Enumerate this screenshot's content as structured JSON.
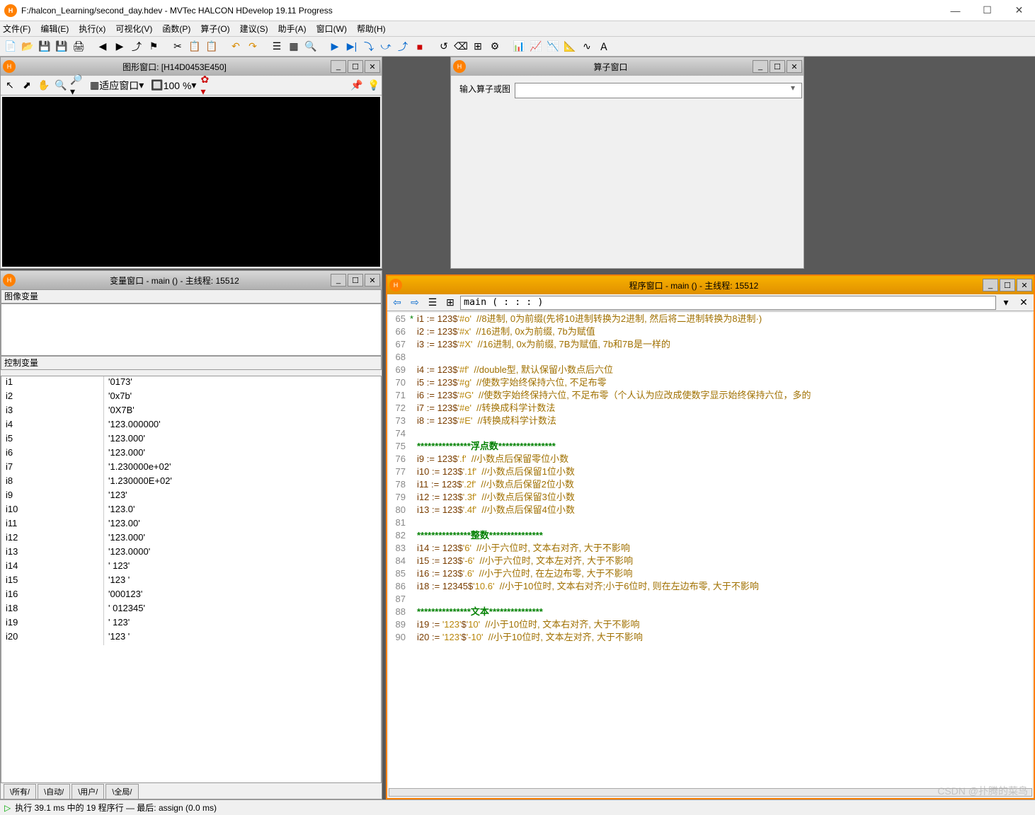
{
  "title": "F:/halcon_Learning/second_day.hdev - MVTec HALCON HDevelop 19.11 Progress",
  "window_controls": {
    "min": "—",
    "max": "☐",
    "close": "✕"
  },
  "menus": [
    "文件(F)",
    "编辑(E)",
    "执行(x)",
    "可视化(V)",
    "函数(P)",
    "算子(O)",
    "建议(S)",
    "助手(A)",
    "窗口(W)",
    "帮助(H)"
  ],
  "graphics_window": {
    "title": "图形窗口: [H14D0453E450]",
    "fit_label": "适应窗口",
    "zoom": "100 %"
  },
  "operator_window": {
    "title": "算子窗口",
    "input_label": "输入算子或图",
    "input_value": ""
  },
  "variable_window": {
    "title": "变量窗口 - main () - 主线程: 15512",
    "image_vars_label": "图像变量",
    "control_vars_label": "控制变量",
    "vars": [
      {
        "n": "i1",
        "v": "'0173'"
      },
      {
        "n": "i2",
        "v": "'0x7b'"
      },
      {
        "n": "i3",
        "v": "'0X7B'"
      },
      {
        "n": "i4",
        "v": "'123.000000'"
      },
      {
        "n": "i5",
        "v": "'123.000'"
      },
      {
        "n": "i6",
        "v": "'123.000'"
      },
      {
        "n": "i7",
        "v": "'1.230000e+02'"
      },
      {
        "n": "i8",
        "v": "'1.230000E+02'"
      },
      {
        "n": "i9",
        "v": "'123'"
      },
      {
        "n": "i10",
        "v": "'123.0'"
      },
      {
        "n": "i11",
        "v": "'123.00'"
      },
      {
        "n": "i12",
        "v": "'123.000'"
      },
      {
        "n": "i13",
        "v": "'123.0000'"
      },
      {
        "n": "i14",
        "v": "'   123'"
      },
      {
        "n": "i15",
        "v": "'123   '"
      },
      {
        "n": "i16",
        "v": "'000123'"
      },
      {
        "n": "i18",
        "v": "'    012345'"
      },
      {
        "n": "i19",
        "v": "'       123'"
      },
      {
        "n": "i20",
        "v": "'123       '"
      }
    ],
    "tabs": [
      "所有",
      "自动",
      "用户",
      "全局"
    ]
  },
  "program_window": {
    "title": "程序窗口 - main () - 主线程: 15512",
    "location": "main ( : : : )",
    "lines": [
      {
        "n": 65,
        "s": "*",
        "t": "i1 := 123$'#o'  //8进制, 0为前缀(先将10进制转换为2进制, 然后将二进制转换为8进制·)"
      },
      {
        "n": 66,
        "s": "",
        "t": "i2 := 123$'#x'  //16进制, 0x为前缀, 7b为赋值"
      },
      {
        "n": 67,
        "s": "",
        "t": "i3 := 123$'#X'  //16进制, 0x为前缀, 7B为赋值, 7b和7B是一样的"
      },
      {
        "n": 68,
        "s": "",
        "t": ""
      },
      {
        "n": 69,
        "s": "",
        "t": "i4 := 123$'#f'  //double型, 默认保留小数点后六位"
      },
      {
        "n": 70,
        "s": "",
        "t": "i5 := 123$'#g'  //使数字始终保持六位, 不足布零"
      },
      {
        "n": 71,
        "s": "",
        "t": "i6 := 123$'#G'  //使数字始终保持六位, 不足布零（个人认为应改成使数字显示始终保持六位，多的"
      },
      {
        "n": 72,
        "s": "",
        "t": "i7 := 123$'#e'  //转换成科学计数法"
      },
      {
        "n": 73,
        "s": "",
        "t": "i8 := 123$'#E'  //转换成科学计数法"
      },
      {
        "n": 74,
        "s": "",
        "t": ""
      },
      {
        "n": 75,
        "s": "",
        "sec": "***************浮点数****************"
      },
      {
        "n": 76,
        "s": "",
        "t": "i9 := 123$'.f'  //小数点后保留零位小数"
      },
      {
        "n": 77,
        "s": "",
        "t": "i10 := 123$'.1f'  //小数点后保留1位小数"
      },
      {
        "n": 78,
        "s": "",
        "t": "i11 := 123$'.2f'  //小数点后保留2位小数"
      },
      {
        "n": 79,
        "s": "",
        "t": "i12 := 123$'.3f'  //小数点后保留3位小数"
      },
      {
        "n": 80,
        "s": "",
        "t": "i13 := 123$'.4f'  //小数点后保留4位小数"
      },
      {
        "n": 81,
        "s": "",
        "t": ""
      },
      {
        "n": 82,
        "s": "",
        "sec": "***************整数***************"
      },
      {
        "n": 83,
        "s": "",
        "t": "i14 := 123$'6'  //小于六位时, 文本右对齐, 大于不影响"
      },
      {
        "n": 84,
        "s": "",
        "t": "i15 := 123$'-6'  //小于六位时, 文本左对齐, 大于不影响"
      },
      {
        "n": 85,
        "s": "",
        "t": "i16 := 123$'.6'  //小于六位时, 在左边布零, 大于不影响"
      },
      {
        "n": 86,
        "s": "",
        "t": "i18 := 12345$'10.6'  //小于10位时, 文本右对齐;小于6位时, 则在左边布零, 大于不影响"
      },
      {
        "n": 87,
        "s": "",
        "t": ""
      },
      {
        "n": 88,
        "s": "",
        "sec": "***************文本***************"
      },
      {
        "n": 89,
        "s": "",
        "t": "i19 := '123'$'10'  //小于10位时, 文本右对齐, 大于不影响"
      },
      {
        "n": 90,
        "s": "",
        "t": "i20 := '123'$'-10'  //小于10位时, 文本左对齐, 大于不影响"
      }
    ]
  },
  "statusbar": {
    "run_icon": "▷",
    "text": "执行 39.1 ms 中的 19 程序行 — 最后: assign (0.0 ms)"
  },
  "watermark": "CSDN @扑腾的菜鸟"
}
